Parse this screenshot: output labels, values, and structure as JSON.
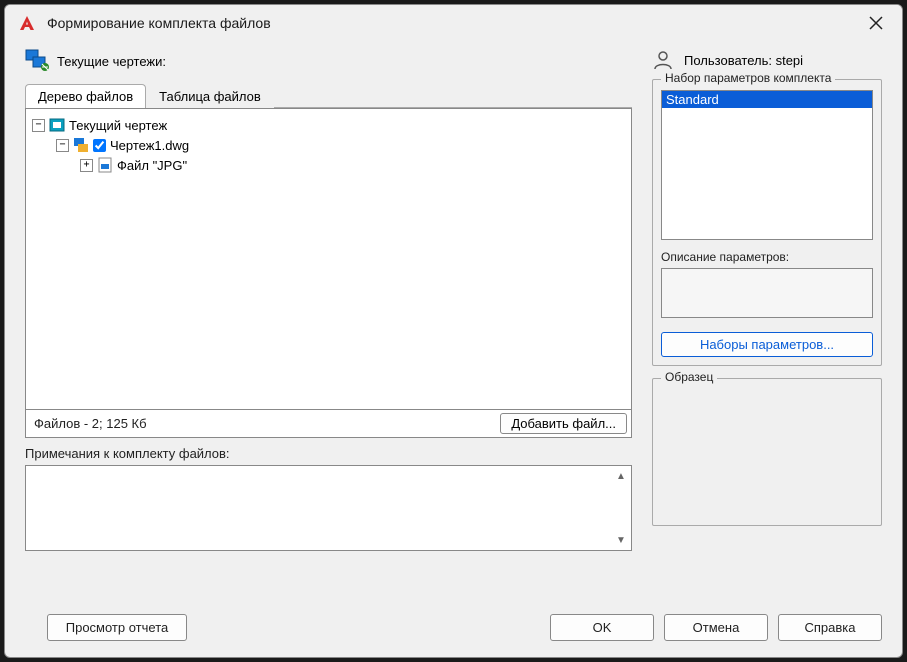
{
  "window": {
    "title": "Формирование комплекта файлов"
  },
  "left": {
    "header": "Текущие чертежи:",
    "tabs": {
      "tree": "Дерево файлов",
      "table": "Таблица файлов"
    },
    "tree": {
      "root": {
        "label": "Текущий чертеж",
        "expanded": true
      },
      "drawing": {
        "label": "Чертеж1.dwg",
        "checked": true,
        "expanded": true
      },
      "child": {
        "label": "Файл \"JPG\"",
        "expanded": false
      }
    },
    "status": "Файлов - 2; 125 Кб",
    "add_file": "Добавить файл...",
    "notes_label": "Примечания к комплекту файлов:",
    "notes_value": ""
  },
  "right": {
    "user_label": "Пользователь: stepi",
    "paramset_group": "Набор параметров комплекта",
    "paramset_items": [
      "Standard"
    ],
    "param_desc_label": "Описание параметров:",
    "param_desc_value": "",
    "paramsets_button": "Наборы параметров...",
    "sample_group": "Образец"
  },
  "buttons": {
    "preview": "Просмотр отчета",
    "ok": "OK",
    "cancel": "Отмена",
    "help": "Справка"
  }
}
